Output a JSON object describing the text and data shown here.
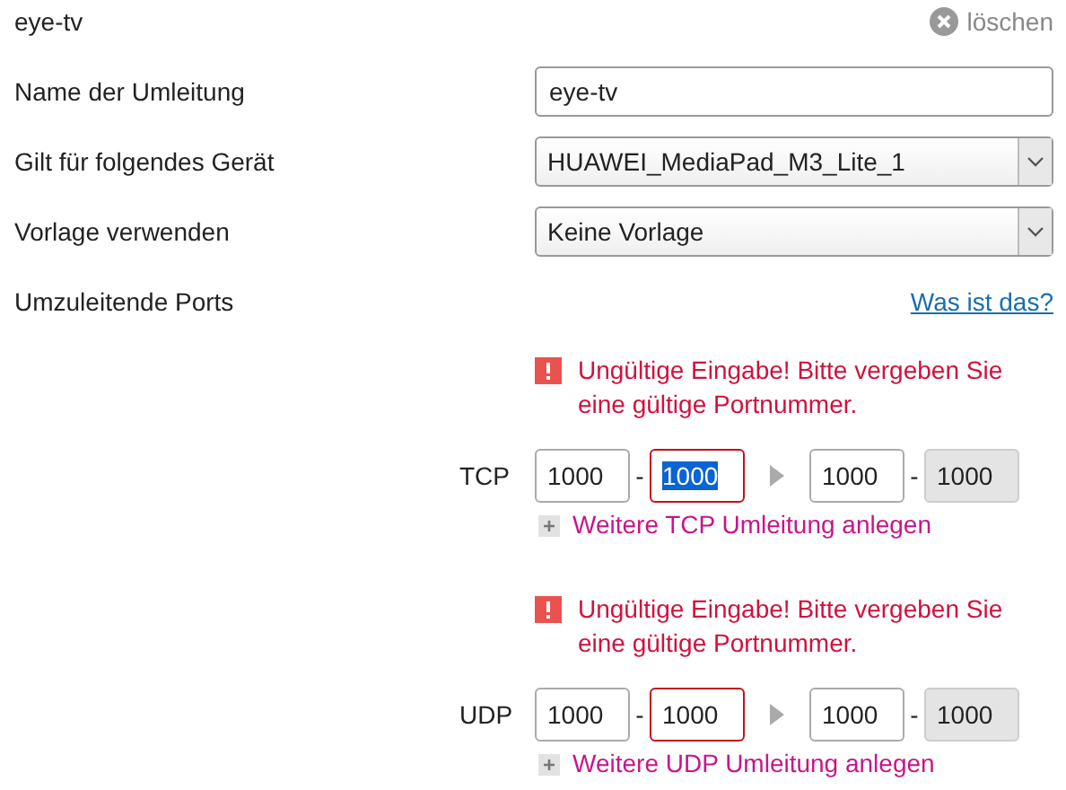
{
  "title": "eye-tv",
  "delete_button": {
    "label": "löschen"
  },
  "fields": [
    {
      "kind": "text",
      "label": "Name der Umleitung",
      "value": "eye-tv"
    },
    {
      "kind": "select",
      "label": "Gilt für folgendes Gerät",
      "value": "HUAWEI_MediaPad_M3_Lite_1"
    },
    {
      "kind": "select",
      "label": "Vorlage verwenden",
      "value": "Keine Vorlage"
    }
  ],
  "ports": {
    "label": "Umzuleitende Ports",
    "help_link": "Was ist das?",
    "groups": [
      {
        "protocol": "TCP",
        "error": "Ungültige Eingabe! Bitte vergeben Sie eine gültige Portnummer.",
        "add_link": "Weitere TCP Umleitung anlegen",
        "source": {
          "start": {
            "value": "1000",
            "invalid": false,
            "highlighted": false,
            "disabled": false
          },
          "separator": "-",
          "end": {
            "value": "1000",
            "invalid": true,
            "highlighted": true,
            "disabled": false
          }
        },
        "target": {
          "start": {
            "value": "1000",
            "invalid": false,
            "highlighted": false,
            "disabled": false
          },
          "separator": "-",
          "end": {
            "value": "1000",
            "invalid": false,
            "highlighted": false,
            "disabled": true
          }
        }
      },
      {
        "protocol": "UDP",
        "error": "Ungültige Eingabe! Bitte vergeben Sie eine gültige Portnummer.",
        "add_link": "Weitere UDP Umleitung anlegen",
        "source": {
          "start": {
            "value": "1000",
            "invalid": false,
            "highlighted": false,
            "disabled": false
          },
          "separator": "-",
          "end": {
            "value": "1000",
            "invalid": true,
            "highlighted": false,
            "disabled": false
          }
        },
        "target": {
          "start": {
            "value": "1000",
            "invalid": false,
            "highlighted": false,
            "disabled": false
          },
          "separator": "-",
          "end": {
            "value": "1000",
            "invalid": false,
            "highlighted": false,
            "disabled": true
          }
        }
      }
    ]
  }
}
